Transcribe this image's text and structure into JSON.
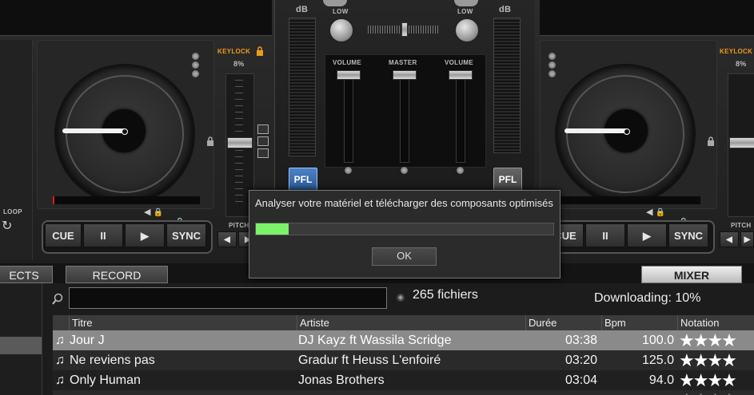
{
  "deck_left": {
    "keylock_label": "KEYLOCK",
    "pitch_value": "8%",
    "pitch_label": "PITCH",
    "loop_label": "LOOP",
    "buttons": [
      "CUE",
      "II",
      "▶",
      "SYNC"
    ]
  },
  "deck_right": {
    "keylock_label": "KEYLOCK",
    "pitch_value": "8%",
    "pitch_label": "PITCH",
    "buttons": [
      "CUE",
      "II",
      "▶",
      "SYNC"
    ]
  },
  "mixer": {
    "db_left": "dB",
    "db_right": "dB",
    "low_left": "LOW",
    "low_right": "LOW",
    "volume_left": "VOLUME",
    "master": "MASTER",
    "volume_right": "VOLUME",
    "pfl_left": "PFL",
    "pfl_right": "PFL"
  },
  "tabs": {
    "effects": "ECTS",
    "record": "RECORD",
    "mixer": "MIXER"
  },
  "browser": {
    "search_value": "",
    "file_count": "265 fichiers",
    "download_status": "Downloading: 10%",
    "columns": [
      "Titre",
      "Artiste",
      "Durée",
      "Bpm",
      "Notation"
    ],
    "rows": [
      {
        "title": "Jour J",
        "artist": "DJ Kayz ft Wassila  Scridge",
        "duration": "03:38",
        "bpm": "100.0",
        "stars": "★★★★"
      },
      {
        "title": "Ne reviens pas",
        "artist": "Gradur ft Heuss L'enfoiré",
        "duration": "03:20",
        "bpm": "125.0",
        "stars": "★★★★"
      },
      {
        "title": "Only Human",
        "artist": "Jonas Brothers",
        "duration": "03:04",
        "bpm": "94.0",
        "stars": "★★★★"
      },
      {
        "title": "",
        "artist": "",
        "duration": "",
        "bpm": "",
        "stars": "★★★★"
      }
    ]
  },
  "dialog": {
    "message": "Analyser votre matériel et télécharger des composants optimisés",
    "progress": 0.11,
    "ok_label": "OK"
  }
}
